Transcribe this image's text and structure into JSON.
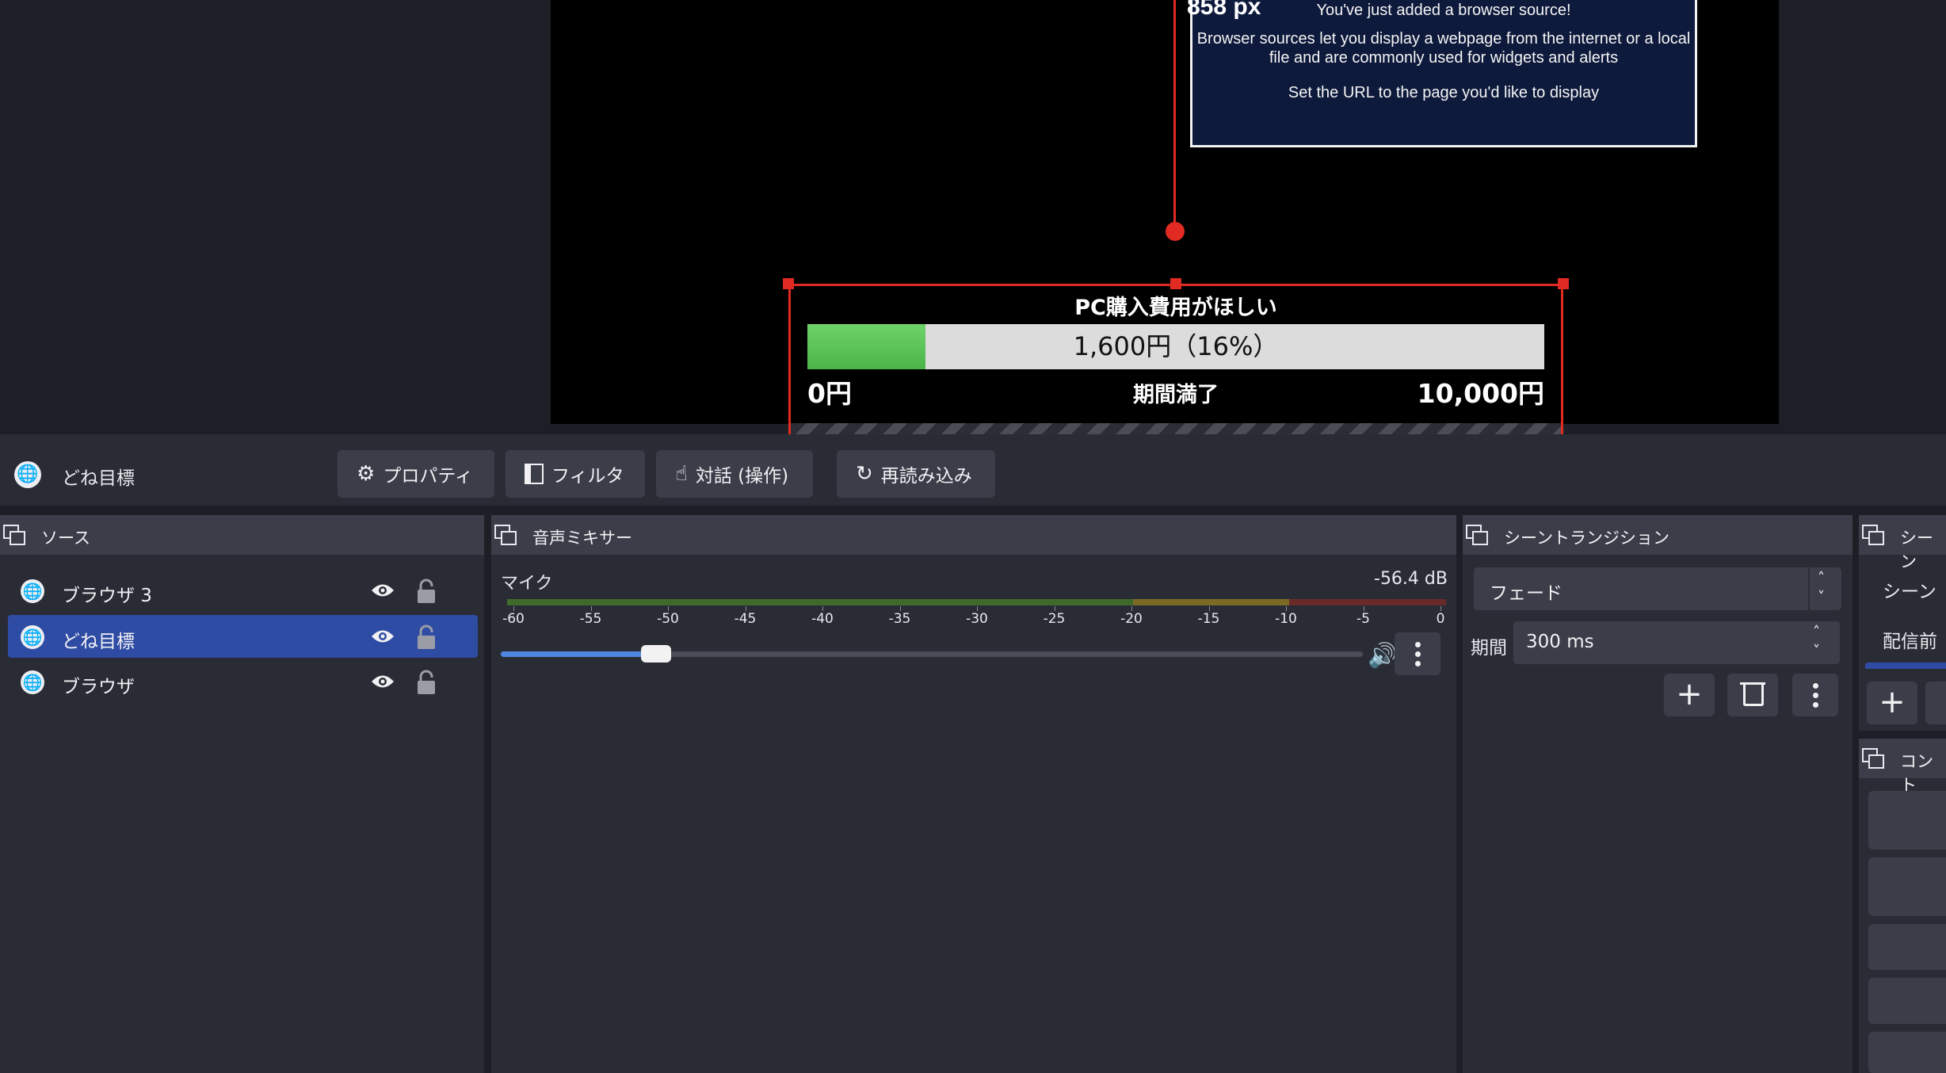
{
  "preview": {
    "size_readout": "858 px",
    "browser_msg": {
      "line1": "You've just added a browser source!",
      "line2a": "Browser sources let you display a webpage from the internet or a local",
      "line2b": "file and are commonly used for widgets and alerts",
      "line3": "Set the URL to the page you'd like to display"
    },
    "goal": {
      "title": "PC購入費用がほしい",
      "progress_text": "1,600円（16%）",
      "progress_fraction": 0.16,
      "min_label": "0円",
      "center_label": "期間満了",
      "max_label": "10,000円"
    }
  },
  "toolbar": {
    "selected_source": "どね目標",
    "properties": "プロパティ",
    "filters": "フィルタ",
    "interact": "対話 (操作)",
    "refresh": "再読み込み"
  },
  "sources": {
    "title": "ソース",
    "items": [
      {
        "label": "ブラウザ 3",
        "selected": false
      },
      {
        "label": "どね目標",
        "selected": true
      },
      {
        "label": "ブラウザ",
        "selected": false
      }
    ]
  },
  "mixer": {
    "title": "音声ミキサー",
    "channel": "マイク",
    "level": "-56.4 dB",
    "ticks": [
      "-60",
      "-55",
      "-50",
      "-45",
      "-40",
      "-35",
      "-30",
      "-25",
      "-20",
      "-15",
      "-10",
      "-5",
      "0"
    ],
    "volume_fraction": 0.18
  },
  "transitions": {
    "title": "シーントランジション",
    "selected": "フェード",
    "duration_label": "期間",
    "duration_value": "300 ms"
  },
  "scenes": {
    "title": "シーン",
    "items": [
      "シーン",
      "配信前"
    ]
  },
  "controls": {
    "title": "コント"
  },
  "colors": {
    "accent": "#2f4ca5",
    "selection": "#e02a22",
    "progress": "#5cc45a"
  }
}
